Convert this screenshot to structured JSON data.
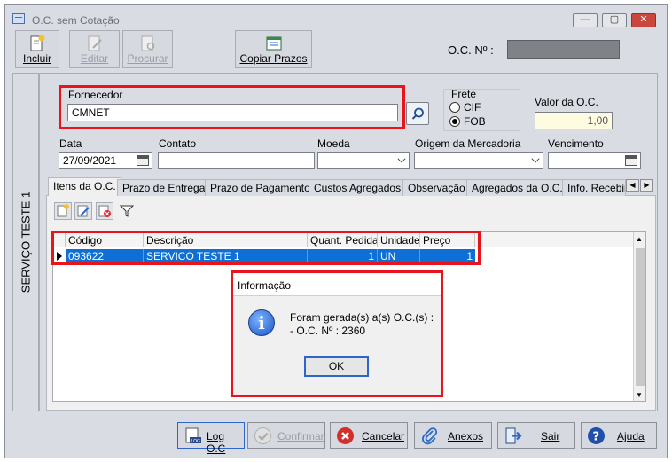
{
  "window": {
    "title": "O.C. sem Cotação",
    "controls": {
      "minimize": "—",
      "maximize": "▢",
      "close": "✕"
    }
  },
  "toolbar": {
    "incluir": "Incluir",
    "editar": "Editar",
    "procurar": "Procurar",
    "copiar_prazos": "Copiar Prazos"
  },
  "header": {
    "oc_label": "O.C. Nº :",
    "oc_value": ""
  },
  "side_tab": {
    "label": "SERVIÇO TESTE 1"
  },
  "form": {
    "fornecedor_label": "Fornecedor",
    "fornecedor_value": "CMNET",
    "frete_label": "Frete",
    "frete_options": [
      "CIF",
      "FOB"
    ],
    "frete_selected": "FOB",
    "valor_label": "Valor da O.C.",
    "valor_value": "1,00",
    "data_label": "Data",
    "data_value": "27/09/2021",
    "contato_label": "Contato",
    "contato_value": "",
    "moeda_label": "Moeda",
    "moeda_value": "",
    "origem_label": "Origem da Mercadoria",
    "origem_value": "",
    "vencimento_label": "Vencimento",
    "vencimento_value": ""
  },
  "tabs": [
    {
      "label": "Itens da O.C."
    },
    {
      "label": "Prazo de Entrega"
    },
    {
      "label": "Prazo de Pagamento"
    },
    {
      "label": "Custos Agregados"
    },
    {
      "label": "Observação"
    },
    {
      "label": "Agregados da O.C."
    },
    {
      "label": "Info. Recebim"
    }
  ],
  "grid": {
    "columns": [
      "Código",
      "Descrição",
      "Quant. Pedida",
      "Unidade",
      "Preço"
    ],
    "rows": [
      {
        "codigo": "093622",
        "descricao": "SERVICO TESTE 1",
        "quant": "1",
        "unidade": "UN",
        "preco": "1"
      }
    ]
  },
  "dialog": {
    "title": "Informação",
    "line1": "Foram gerada(s) a(s) O.C.(s) :",
    "line2": "- O.C. Nº : 2360",
    "ok": "OK"
  },
  "bottom_buttons": {
    "log": "Log O.C",
    "confirmar": "Confirmar",
    "cancelar": "Cancelar",
    "anexos": "Anexos",
    "sair": "Sair",
    "ajuda": "Ajuda"
  },
  "colors": {
    "highlight_red": "#e8131b",
    "selection_blue": "#0e6fd6",
    "window_bg": "#d9dce3"
  }
}
